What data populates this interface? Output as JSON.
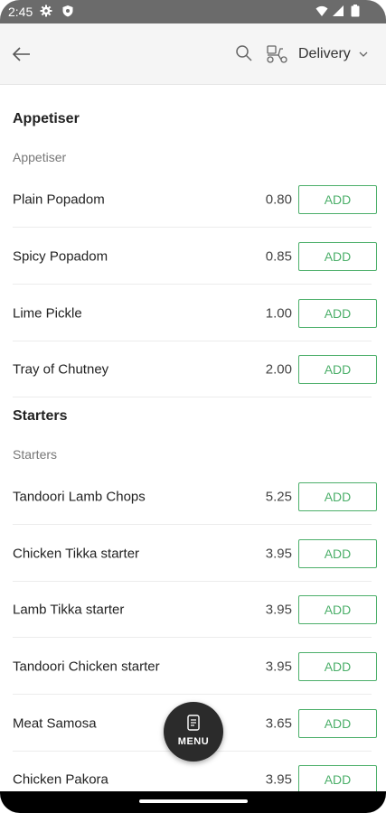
{
  "status_bar": {
    "time": "2:45",
    "icons": [
      "gear-icon",
      "shield-icon",
      "wifi-icon",
      "signal-icon",
      "battery-icon"
    ]
  },
  "header": {
    "back_icon": "arrow-left-icon",
    "search_icon": "search-icon",
    "delivery_icon": "scooter-icon",
    "delivery_label": "Delivery",
    "dropdown_icon": "chevron-down-icon"
  },
  "menu": {
    "sections": [
      {
        "title": "Appetiser",
        "subtitle": "Appetiser",
        "items": [
          {
            "name": "Plain Popadom",
            "price": "0.80",
            "action": "ADD"
          },
          {
            "name": "Spicy Popadom",
            "price": "0.85",
            "action": "ADD"
          },
          {
            "name": "Lime Pickle",
            "price": "1.00",
            "action": "ADD"
          },
          {
            "name": "Tray of Chutney",
            "price": "2.00",
            "action": "ADD"
          }
        ]
      },
      {
        "title": "Starters",
        "subtitle": "Starters",
        "items": [
          {
            "name": "Tandoori Lamb Chops",
            "price": "5.25",
            "action": "ADD"
          },
          {
            "name": "Chicken Tikka starter",
            "price": "3.95",
            "action": "ADD"
          },
          {
            "name": "Lamb Tikka starter",
            "price": "3.95",
            "action": "ADD"
          },
          {
            "name": "Tandoori Chicken starter",
            "price": "3.95",
            "action": "ADD"
          },
          {
            "name": "Meat Samosa",
            "price": "3.65",
            "action": "ADD"
          },
          {
            "name": "Chicken Pakora",
            "price": "3.95",
            "action": "ADD"
          }
        ]
      }
    ]
  },
  "fab": {
    "label": "MENU",
    "icon": "menu-document-icon"
  },
  "colors": {
    "accent_green": "#4caf6a",
    "header_bg": "#f5f5f5",
    "fab_bg": "#2b2b2b"
  }
}
